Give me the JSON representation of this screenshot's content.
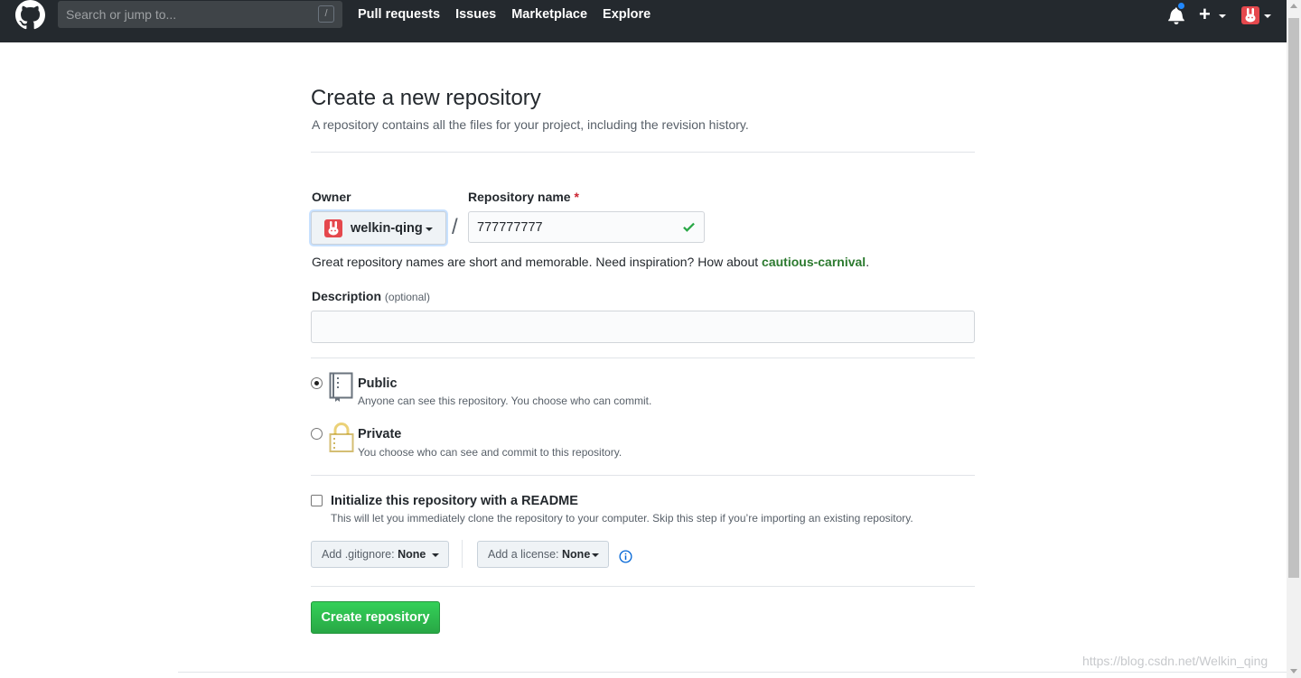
{
  "header": {
    "search_placeholder": "Search or jump to...",
    "search_shortcut": "/",
    "nav": [
      "Pull requests",
      "Issues",
      "Marketplace",
      "Explore"
    ],
    "plus_label": "+"
  },
  "page": {
    "title": "Create a new repository",
    "subtitle": "A repository contains all the files for your project, including the revision history."
  },
  "form": {
    "owner_label": "Owner",
    "owner_value": "welkin-qing",
    "separator": "/",
    "repo_name_label": "Repository name",
    "required_mark": "*",
    "repo_name_value": "777777777",
    "hint_text": "Great repository names are short and memorable. Need inspiration? How about ",
    "hint_suggestion": "cautious-carnival",
    "hint_end": ".",
    "description_label": "Description",
    "description_optional": "(optional)",
    "description_value": "",
    "visibility": {
      "selected": "public",
      "public_title": "Public",
      "public_desc": "Anyone can see this repository. You choose who can commit.",
      "private_title": "Private",
      "private_desc": "You choose who can see and commit to this repository."
    },
    "readme_checked": false,
    "readme_title": "Initialize this repository with a README",
    "readme_desc": "This will let you immediately clone the repository to your computer. Skip this step if you’re importing an existing repository.",
    "gitignore_prefix": "Add .gitignore:",
    "gitignore_value": "None",
    "license_prefix": "Add a license:",
    "license_value": "None",
    "submit_label": "Create repository"
  },
  "watermark": "https://blog.csdn.net/Welkin_qing",
  "colors": {
    "header_bg": "#24292e",
    "primary_green": "#28a745",
    "notification_blue": "#2188ff",
    "avatar_red": "#e5484d"
  }
}
